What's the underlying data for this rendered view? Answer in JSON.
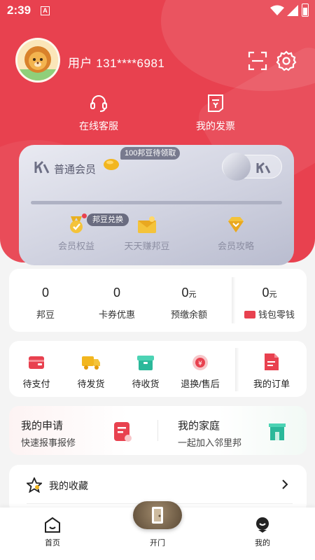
{
  "status_bar": {
    "time": "2:39",
    "notif_letter": "A"
  },
  "profile": {
    "username": "用户 131****6981"
  },
  "quick_actions": [
    {
      "label": "在线客服",
      "icon": "headset-icon"
    },
    {
      "label": "我的发票",
      "icon": "invoice-icon"
    }
  ],
  "vip_card": {
    "level": "普通会员",
    "pending_beans": "100邦豆待领取",
    "exchange_tag": "邦豆兑换",
    "progress": 0,
    "perks": [
      {
        "label": "会员权益",
        "icon": "medal-icon"
      },
      {
        "label": "天天赚邦豆",
        "icon": "envelope-icon"
      },
      {
        "label": "会员攻略",
        "icon": "diamond-icon"
      }
    ]
  },
  "assets": [
    {
      "value": "0",
      "unit": "",
      "label": "邦豆"
    },
    {
      "value": "0",
      "unit": "",
      "label": "卡券优惠"
    },
    {
      "value": "0",
      "unit": "元",
      "label": "预缴余额"
    },
    {
      "value": "0",
      "unit": "元",
      "label": "钱包零钱"
    }
  ],
  "orders": [
    {
      "label": "待支付",
      "icon": "wallet-icon"
    },
    {
      "label": "待发货",
      "icon": "truck-icon"
    },
    {
      "label": "待收货",
      "icon": "box-icon"
    },
    {
      "label": "退换/售后",
      "icon": "refund-icon"
    },
    {
      "label": "我的订单",
      "icon": "order-icon"
    }
  ],
  "services": [
    {
      "title": "我的申请",
      "subtitle": "快速报事报修",
      "icon": "form-icon"
    },
    {
      "title": "我的家庭",
      "subtitle": "一起加入邻里邦",
      "icon": "house-icon"
    }
  ],
  "list_items": [
    {
      "label": "我的收藏",
      "icon": "star-icon"
    }
  ],
  "tabbar": [
    {
      "label": "首页",
      "icon": "home-icon"
    },
    {
      "label": "开门",
      "icon": "door-icon"
    },
    {
      "label": "我的",
      "icon": "profile-icon"
    }
  ],
  "colors": {
    "brand": "#e8414f",
    "vip_text": "#58596e"
  }
}
